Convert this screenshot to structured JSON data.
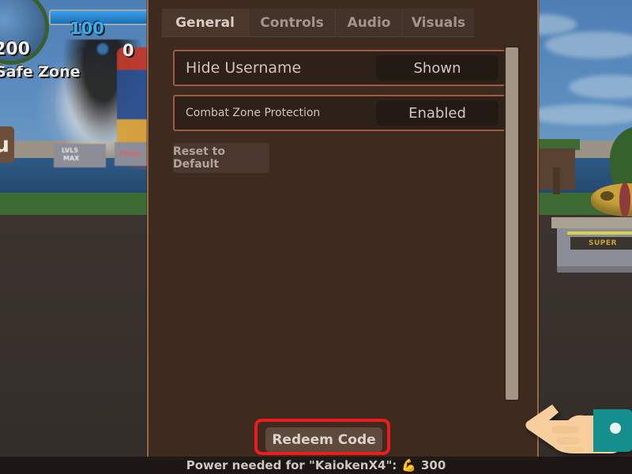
{
  "game_hud": {
    "energy_value": "100",
    "power_value": "200",
    "coin_value": "0",
    "zone_label": "Safe Zone",
    "menu_button_label": "nu",
    "stand_label_1": "LVL5",
    "stand_label_2": "MAX",
    "stand_label_3": "Finish"
  },
  "world": {
    "pedestal_plate_label": "SUPER"
  },
  "panel": {
    "tabs": [
      {
        "label": "General",
        "active": true
      },
      {
        "label": "Controls",
        "active": false
      },
      {
        "label": "Audio",
        "active": false
      },
      {
        "label": "Visuals",
        "active": false
      }
    ],
    "settings": [
      {
        "label": "Hide Username",
        "value": "Shown"
      },
      {
        "label": "Combat Zone Protection",
        "value": "Enabled"
      }
    ],
    "reset_label": "Reset to Default",
    "redeem_label": "Redeem Code"
  },
  "bottom_bar": {
    "power_text": "Power needed for \"KaiokenX4\":",
    "power_icon": "💪",
    "power_amount": "300"
  },
  "colors": {
    "panel_bg": "#3d2b20",
    "panel_border": "#9a6a47",
    "row_highlight": "#a15a3e",
    "redeem_highlight": "#ee1c1c",
    "scrollbar_thumb": "#a39585",
    "cursor_sleeve": "#158e8e",
    "cursor_skin": "#f8cf9c"
  }
}
